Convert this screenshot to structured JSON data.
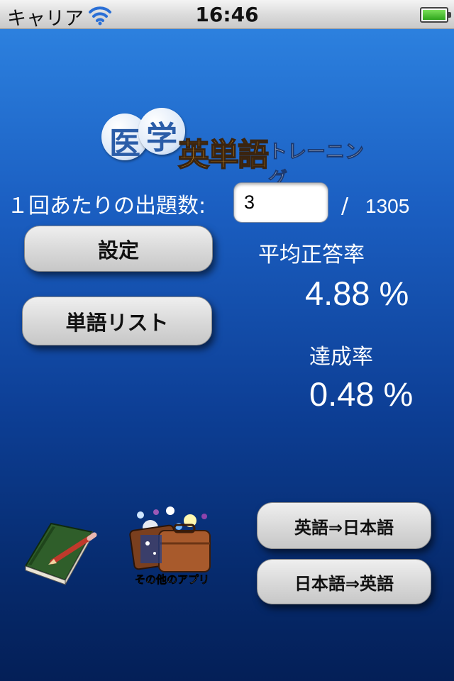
{
  "status_bar": {
    "carrier": "キャリア",
    "time": "16:46"
  },
  "logo": {
    "char1": "医",
    "char2": "学",
    "main": "英単語",
    "sub": "トレーニング"
  },
  "questions": {
    "label": "１回あたりの出題数:",
    "value": "3",
    "separator": "/",
    "total": "1305"
  },
  "buttons": {
    "settings": "設定",
    "word_list": "単語リスト",
    "en_to_ja": "英語⇒日本語",
    "ja_to_en": "日本語⇒英語"
  },
  "stats": {
    "average_label": "平均正答率",
    "average_value": "4.88 %",
    "achievement_label": "達成率",
    "achievement_value": "0.48 %"
  },
  "icons": {
    "notebook": "notebook-pencil-icon",
    "other_apps": "suitcase-sparkles-icon",
    "other_apps_label": "その他のアプリ"
  },
  "colors": {
    "accent_logo": "#f0a422",
    "button_text": "#111111",
    "background_top": "#2f86e3",
    "background_bottom": "#041f57"
  }
}
